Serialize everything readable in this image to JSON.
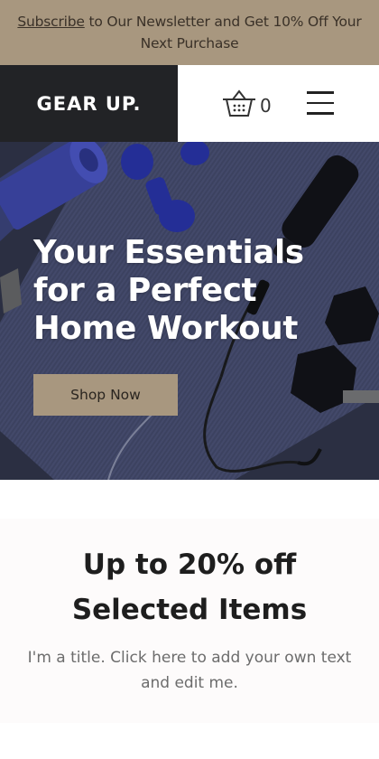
{
  "announcement": {
    "link_text": "Subscribe",
    "text": " to Our Newsletter and Get 10% Off Your Next Purchase"
  },
  "header": {
    "brand": "GEAR UP.",
    "cart_count": "0",
    "icons": [
      "basket-icon",
      "menu-icon"
    ]
  },
  "hero": {
    "title_lines": [
      "Your Essentials",
      "for a Perfect",
      "Home Workout"
    ],
    "button_label": "Shop Now"
  },
  "promo": {
    "title_line1": "Up to 20% off",
    "title_line2": "Selected Items",
    "text": "I'm a title. Click here to add your own text and edit me."
  },
  "colors": {
    "accent": "#a8977f",
    "brand_bg": "#222326",
    "hero_bg": "#3b3f5c"
  }
}
